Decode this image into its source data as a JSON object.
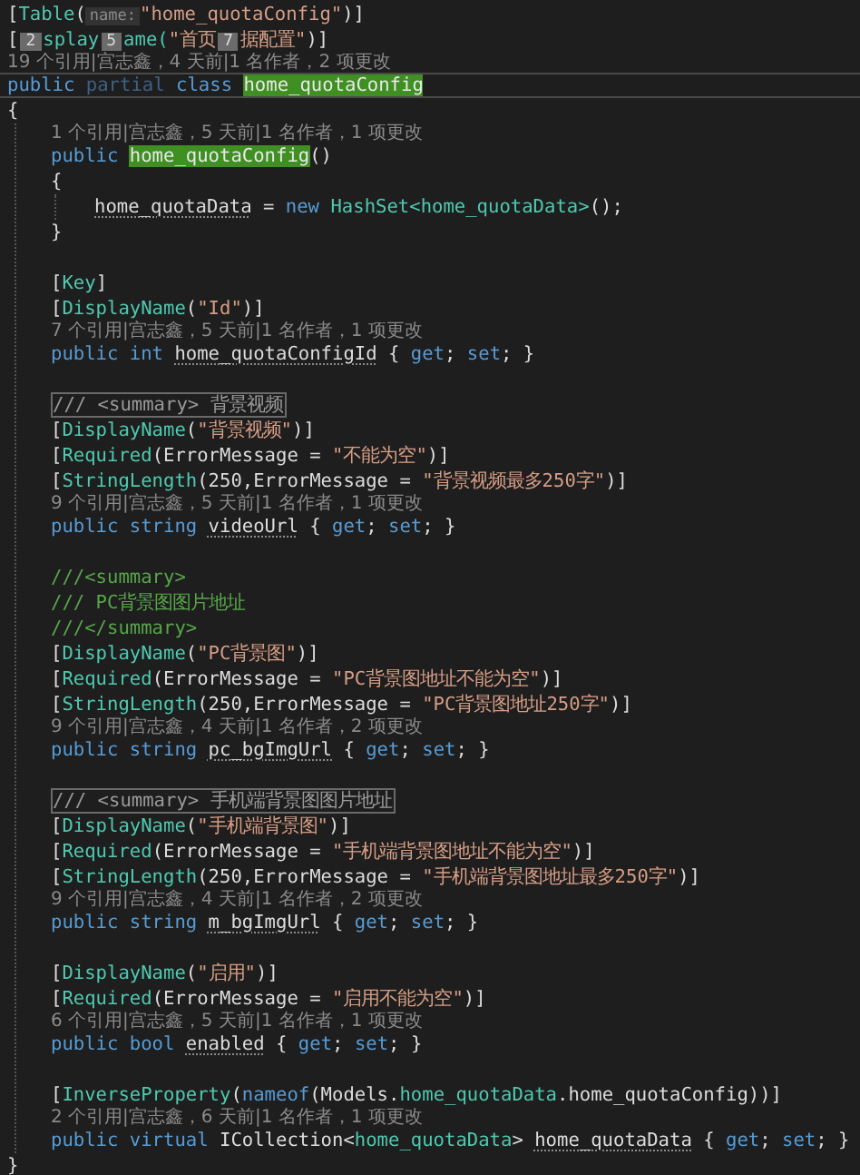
{
  "editor": {
    "lines": [
      {
        "kind": "code",
        "current": false,
        "tokens": [
          {
            "kind": "punct",
            "text": "["
          },
          {
            "kind": "attr",
            "text": "Table"
          },
          {
            "kind": "punct",
            "text": "("
          },
          {
            "kind": "hint",
            "text": "name:"
          },
          {
            "kind": "str",
            "text": "\"home_quotaConfig\""
          },
          {
            "kind": "punct",
            "text": ")]"
          }
        ]
      },
      {
        "kind": "code",
        "current": false,
        "tokens": [
          {
            "kind": "punct",
            "text": "["
          },
          {
            "kind": "badge",
            "text": "2"
          },
          {
            "kind": "attr",
            "text": "splay"
          },
          {
            "kind": "badge",
            "text": "5"
          },
          {
            "kind": "attr",
            "text": "ame("
          },
          {
            "kind": "str",
            "text": "\"首页"
          },
          {
            "kind": "badge",
            "text": "7"
          },
          {
            "kind": "str",
            "text": "据配置\""
          },
          {
            "kind": "punct",
            "text": ")]"
          }
        ]
      },
      {
        "kind": "lens",
        "text": "19 个引用|宫志鑫，4 天前|1 名作者，2 项更改"
      },
      {
        "kind": "code",
        "current": true,
        "tokens": [
          {
            "kind": "kw",
            "text": "public "
          },
          {
            "kind": "kwdim",
            "text": "partial "
          },
          {
            "kind": "kw",
            "text": "class "
          },
          {
            "kind": "type",
            "text": "home_quotaConfig",
            "highlight": true
          }
        ]
      },
      {
        "kind": "code",
        "current": false,
        "tokens": [
          {
            "kind": "punct",
            "text": "{"
          }
        ],
        "children": [
          {
            "kind": "lens",
            "text": "1 个引用|宫志鑫，5 天前|1 名作者，1 项更改"
          },
          {
            "kind": "code",
            "current": false,
            "tokens": [
              {
                "kind": "kw",
                "text": "public "
              },
              {
                "kind": "type",
                "text": "home_quotaConfig",
                "highlight": true
              },
              {
                "kind": "punct",
                "text": "()"
              }
            ]
          },
          {
            "kind": "code",
            "current": false,
            "tokens": [
              {
                "kind": "punct",
                "text": "{"
              }
            ],
            "children": [
              {
                "kind": "code",
                "current": false,
                "tokens": [
                  {
                    "kind": "ident",
                    "text": "home_quotaData",
                    "underline": true
                  },
                  {
                    "kind": "punct",
                    "text": " = "
                  },
                  {
                    "kind": "kw",
                    "text": "new "
                  },
                  {
                    "kind": "type",
                    "text": "HashSet<home_quotaData>"
                  },
                  {
                    "kind": "punct",
                    "text": "();"
                  }
                ]
              }
            ]
          },
          {
            "kind": "code",
            "current": false,
            "tokens": [
              {
                "kind": "punct",
                "text": "}"
              }
            ]
          },
          {
            "kind": "blank"
          },
          {
            "kind": "code",
            "current": false,
            "tokens": [
              {
                "kind": "punct",
                "text": "["
              },
              {
                "kind": "attr",
                "text": "Key"
              },
              {
                "kind": "punct",
                "text": "]"
              }
            ]
          },
          {
            "kind": "code",
            "current": false,
            "tokens": [
              {
                "kind": "punct",
                "text": "["
              },
              {
                "kind": "attr",
                "text": "DisplayName"
              },
              {
                "kind": "punct",
                "text": "("
              },
              {
                "kind": "str",
                "text": "\"Id\""
              },
              {
                "kind": "punct",
                "text": ")]"
              }
            ]
          },
          {
            "kind": "lens",
            "text": "7 个引用|宫志鑫，5 天前|1 名作者，1 项更改"
          },
          {
            "kind": "code",
            "current": false,
            "tokens": [
              {
                "kind": "kw",
                "text": "public int "
              },
              {
                "kind": "ident",
                "text": "home_quotaConfigId",
                "underline": true
              },
              {
                "kind": "punct",
                "text": " { "
              },
              {
                "kind": "kw",
                "text": "get"
              },
              {
                "kind": "punct",
                "text": "; "
              },
              {
                "kind": "kw",
                "text": "set"
              },
              {
                "kind": "punct",
                "text": "; }"
              }
            ]
          },
          {
            "kind": "blank"
          },
          {
            "kind": "code",
            "current": false,
            "tokens": [
              {
                "kind": "collapsed",
                "text": "/// <summary> 背景视频"
              }
            ]
          },
          {
            "kind": "code",
            "current": false,
            "tokens": [
              {
                "kind": "punct",
                "text": "["
              },
              {
                "kind": "attr",
                "text": "DisplayName"
              },
              {
                "kind": "punct",
                "text": "("
              },
              {
                "kind": "str",
                "text": "\"背景视频\""
              },
              {
                "kind": "punct",
                "text": ")]"
              }
            ]
          },
          {
            "kind": "code",
            "current": false,
            "tokens": [
              {
                "kind": "punct",
                "text": "["
              },
              {
                "kind": "attr",
                "text": "Required"
              },
              {
                "kind": "punct",
                "text": "(ErrorMessage = "
              },
              {
                "kind": "str",
                "text": "\"不能为空\""
              },
              {
                "kind": "punct",
                "text": ")]"
              }
            ]
          },
          {
            "kind": "code",
            "current": false,
            "tokens": [
              {
                "kind": "punct",
                "text": "["
              },
              {
                "kind": "attr",
                "text": "StringLength"
              },
              {
                "kind": "punct",
                "text": "(250,ErrorMessage = "
              },
              {
                "kind": "str",
                "text": "\"背景视频最多250字\""
              },
              {
                "kind": "punct",
                "text": ")]"
              }
            ]
          },
          {
            "kind": "lens",
            "text": "9 个引用|宫志鑫，5 天前|1 名作者，1 项更改"
          },
          {
            "kind": "code",
            "current": false,
            "tokens": [
              {
                "kind": "kw",
                "text": "public string "
              },
              {
                "kind": "ident",
                "text": "videoUrl",
                "underline": true
              },
              {
                "kind": "punct",
                "text": " { "
              },
              {
                "kind": "kw",
                "text": "get"
              },
              {
                "kind": "punct",
                "text": "; "
              },
              {
                "kind": "kw",
                "text": "set"
              },
              {
                "kind": "punct",
                "text": "; }"
              }
            ]
          },
          {
            "kind": "blank"
          },
          {
            "kind": "code",
            "current": false,
            "tokens": [
              {
                "kind": "comment",
                "text": "///<summary>"
              }
            ]
          },
          {
            "kind": "code",
            "current": false,
            "tokens": [
              {
                "kind": "comment",
                "text": "/// PC背景图图片地址"
              }
            ]
          },
          {
            "kind": "code",
            "current": false,
            "tokens": [
              {
                "kind": "comment",
                "text": "///</summary>"
              }
            ]
          },
          {
            "kind": "code",
            "current": false,
            "tokens": [
              {
                "kind": "punct",
                "text": "["
              },
              {
                "kind": "attr",
                "text": "DisplayName"
              },
              {
                "kind": "punct",
                "text": "("
              },
              {
                "kind": "str",
                "text": "\"PC背景图\""
              },
              {
                "kind": "punct",
                "text": ")]"
              }
            ]
          },
          {
            "kind": "code",
            "current": false,
            "tokens": [
              {
                "kind": "punct",
                "text": "["
              },
              {
                "kind": "attr",
                "text": "Required"
              },
              {
                "kind": "punct",
                "text": "(ErrorMessage = "
              },
              {
                "kind": "str",
                "text": "\"PC背景图地址不能为空\""
              },
              {
                "kind": "punct",
                "text": ")]"
              }
            ]
          },
          {
            "kind": "code",
            "current": false,
            "tokens": [
              {
                "kind": "punct",
                "text": "["
              },
              {
                "kind": "attr",
                "text": "StringLength"
              },
              {
                "kind": "punct",
                "text": "(250,ErrorMessage = "
              },
              {
                "kind": "str",
                "text": "\"PC背景图地址250字\""
              },
              {
                "kind": "punct",
                "text": ")]"
              }
            ]
          },
          {
            "kind": "lens",
            "text": "9 个引用|宫志鑫，4 天前|1 名作者，2 项更改"
          },
          {
            "kind": "code",
            "current": false,
            "tokens": [
              {
                "kind": "kw",
                "text": "public string "
              },
              {
                "kind": "ident",
                "text": "pc_bgImgUrl",
                "underline": true
              },
              {
                "kind": "punct",
                "text": " { "
              },
              {
                "kind": "kw",
                "text": "get"
              },
              {
                "kind": "punct",
                "text": "; "
              },
              {
                "kind": "kw",
                "text": "set"
              },
              {
                "kind": "punct",
                "text": "; }"
              }
            ]
          },
          {
            "kind": "blank"
          },
          {
            "kind": "code",
            "current": false,
            "tokens": [
              {
                "kind": "collapsed",
                "text": "/// <summary> 手机端背景图图片地址"
              }
            ]
          },
          {
            "kind": "code",
            "current": false,
            "tokens": [
              {
                "kind": "punct",
                "text": "["
              },
              {
                "kind": "attr",
                "text": "DisplayName"
              },
              {
                "kind": "punct",
                "text": "("
              },
              {
                "kind": "str",
                "text": "\"手机端背景图\""
              },
              {
                "kind": "punct",
                "text": ")]"
              }
            ]
          },
          {
            "kind": "code",
            "current": false,
            "tokens": [
              {
                "kind": "punct",
                "text": "["
              },
              {
                "kind": "attr",
                "text": "Required"
              },
              {
                "kind": "punct",
                "text": "(ErrorMessage = "
              },
              {
                "kind": "str",
                "text": "\"手机端背景图地址不能为空\""
              },
              {
                "kind": "punct",
                "text": ")]"
              }
            ]
          },
          {
            "kind": "code",
            "current": false,
            "tokens": [
              {
                "kind": "punct",
                "text": "["
              },
              {
                "kind": "attr",
                "text": "StringLength"
              },
              {
                "kind": "punct",
                "text": "(250,ErrorMessage = "
              },
              {
                "kind": "str",
                "text": "\"手机端背景图地址最多250字\""
              },
              {
                "kind": "punct",
                "text": ")]"
              }
            ]
          },
          {
            "kind": "lens",
            "text": "9 个引用|宫志鑫，4 天前|1 名作者，2 项更改"
          },
          {
            "kind": "code",
            "current": false,
            "tokens": [
              {
                "kind": "kw",
                "text": "public string "
              },
              {
                "kind": "ident",
                "text": "m_bgImgUrl",
                "underline": true
              },
              {
                "kind": "punct",
                "text": " { "
              },
              {
                "kind": "kw",
                "text": "get"
              },
              {
                "kind": "punct",
                "text": "; "
              },
              {
                "kind": "kw",
                "text": "set"
              },
              {
                "kind": "punct",
                "text": "; }"
              }
            ]
          },
          {
            "kind": "blank"
          },
          {
            "kind": "code",
            "current": false,
            "tokens": [
              {
                "kind": "punct",
                "text": "["
              },
              {
                "kind": "attr",
                "text": "DisplayName"
              },
              {
                "kind": "punct",
                "text": "("
              },
              {
                "kind": "str",
                "text": "\"启用\""
              },
              {
                "kind": "punct",
                "text": ")]"
              }
            ]
          },
          {
            "kind": "code",
            "current": false,
            "tokens": [
              {
                "kind": "punct",
                "text": "["
              },
              {
                "kind": "attr",
                "text": "Required"
              },
              {
                "kind": "punct",
                "text": "(ErrorMessage = "
              },
              {
                "kind": "str",
                "text": "\"启用不能为空\""
              },
              {
                "kind": "punct",
                "text": ")]"
              }
            ]
          },
          {
            "kind": "lens",
            "text": "6 个引用|宫志鑫，5 天前|1 名作者，1 项更改"
          },
          {
            "kind": "code",
            "current": false,
            "tokens": [
              {
                "kind": "kw",
                "text": "public bool "
              },
              {
                "kind": "ident",
                "text": "enabled",
                "underline": true
              },
              {
                "kind": "punct",
                "text": " { "
              },
              {
                "kind": "kw",
                "text": "get"
              },
              {
                "kind": "punct",
                "text": "; "
              },
              {
                "kind": "kw",
                "text": "set"
              },
              {
                "kind": "punct",
                "text": "; }"
              }
            ]
          },
          {
            "kind": "blank"
          },
          {
            "kind": "code",
            "current": false,
            "tokens": [
              {
                "kind": "punct",
                "text": "["
              },
              {
                "kind": "attr",
                "text": "InverseProperty"
              },
              {
                "kind": "punct",
                "text": "("
              },
              {
                "kind": "kw",
                "text": "nameof"
              },
              {
                "kind": "punct",
                "text": "(Models."
              },
              {
                "kind": "type",
                "text": "home_quotaData"
              },
              {
                "kind": "punct",
                "text": ".home_quotaConfig))]"
              }
            ]
          },
          {
            "kind": "lens",
            "text": "2 个引用|宫志鑫，6 天前|1 名作者，1 项更改"
          },
          {
            "kind": "code",
            "current": false,
            "tokens": [
              {
                "kind": "kw",
                "text": "public virtual "
              },
              {
                "kind": "punct",
                "text": "ICollection<"
              },
              {
                "kind": "type",
                "text": "home_quotaData"
              },
              {
                "kind": "punct",
                "text": "> "
              },
              {
                "kind": "ident",
                "text": "home_quotaData",
                "underline": true
              },
              {
                "kind": "punct",
                "text": " { "
              },
              {
                "kind": "kw",
                "text": "get"
              },
              {
                "kind": "punct",
                "text": "; "
              },
              {
                "kind": "kw",
                "text": "set"
              },
              {
                "kind": "punct",
                "text": "; }"
              }
            ]
          }
        ]
      },
      {
        "kind": "code",
        "current": false,
        "tokens": [
          {
            "kind": "punct",
            "text": "}"
          }
        ]
      }
    ]
  }
}
